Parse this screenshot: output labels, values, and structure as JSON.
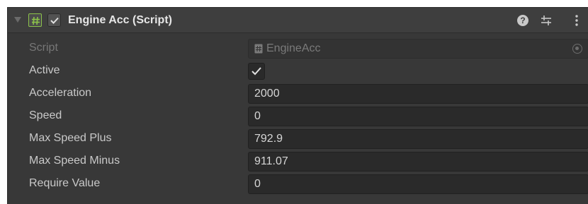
{
  "component": {
    "title": "Engine Acc (Script)",
    "enabled": true,
    "icons": {
      "foldout": "foldout-arrow-icon",
      "script": "csharp-script-icon",
      "help": "help-icon",
      "presets": "preset-icon",
      "menu": "kebab-menu-icon"
    }
  },
  "fields": {
    "script": {
      "label": "Script",
      "value": "EngineAcc"
    },
    "active": {
      "label": "Active",
      "checked": true
    },
    "acceleration": {
      "label": "Acceleration",
      "value": "2000"
    },
    "speed": {
      "label": "Speed",
      "value": "0"
    },
    "max_speed_plus": {
      "label": "Max Speed Plus",
      "value": "792.9"
    },
    "max_speed_minus": {
      "label": "Max Speed Minus",
      "value": "911.07"
    },
    "require_value": {
      "label": "Require Value",
      "value": "0"
    }
  },
  "colors": {
    "panel_bg": "#383838",
    "header_bg": "#3e3e3e",
    "field_bg": "#2a2a2a",
    "script_icon_accent": "#8cc34a"
  }
}
